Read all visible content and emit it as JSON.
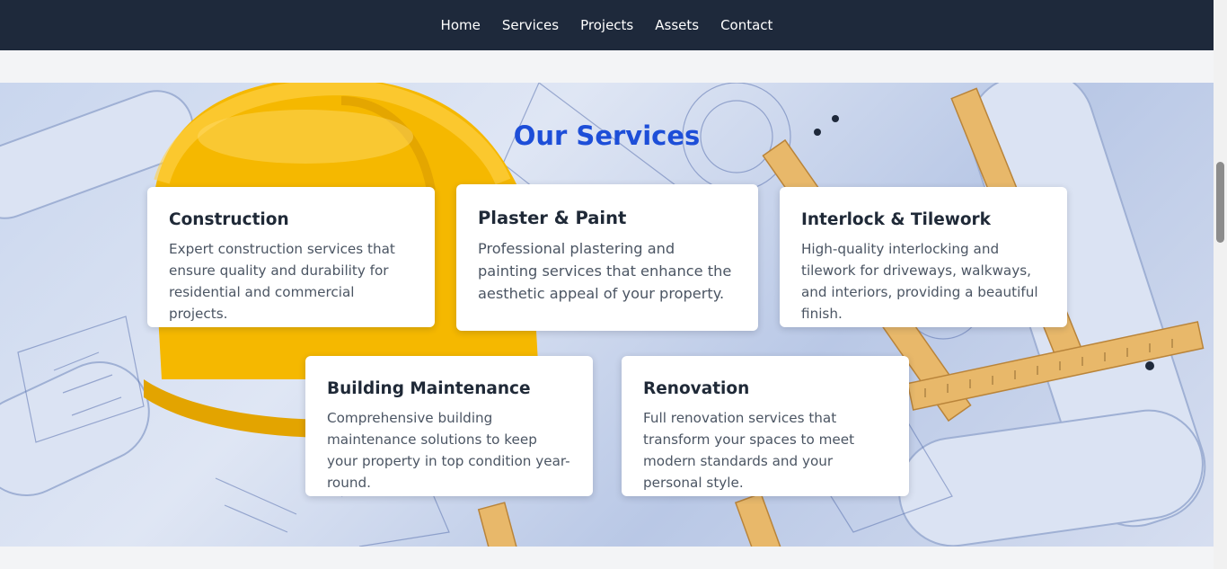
{
  "nav": {
    "items": [
      {
        "label": "Home"
      },
      {
        "label": "Services"
      },
      {
        "label": "Projects"
      },
      {
        "label": "Assets"
      },
      {
        "label": "Contact"
      }
    ]
  },
  "services": {
    "title": "Our Services",
    "cards": [
      {
        "title": "Construction",
        "text": "Expert construction services that ensure quality and durability for residential and commercial projects."
      },
      {
        "title": "Plaster & Paint",
        "text": "Professional plastering and painting services that enhance the aesthetic appeal of your property."
      },
      {
        "title": "Interlock & Tilework",
        "text": "High-quality interlocking and tilework for driveways, walkways, and interiors, providing a beautiful finish."
      },
      {
        "title": "Building Maintenance",
        "text": "Comprehensive building maintenance solutions to keep your property in top condition year-round."
      },
      {
        "title": "Renovation",
        "text": "Full renovation services that transform your spaces to meet modern standards and your personal style."
      }
    ]
  },
  "colors": {
    "navbar_bg": "#1e293b",
    "title_accent": "#1d4ed8",
    "page_bg": "#f3f4f6"
  },
  "background_image": "construction-blueprints-hardhat-ruler"
}
